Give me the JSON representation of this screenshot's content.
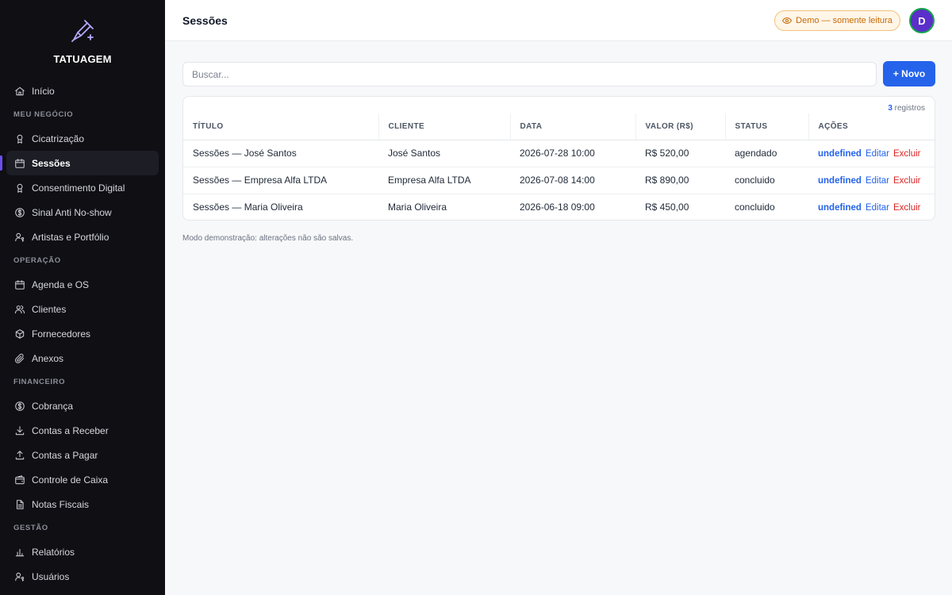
{
  "brand": {
    "name": "TATUAGEM"
  },
  "sidebar": {
    "items": [
      {
        "label": "Início",
        "icon": "home-icon"
      },
      {
        "section": "MEU NEGÓCIO"
      },
      {
        "label": "Cicatrização",
        "icon": "award-icon"
      },
      {
        "label": "Sessões",
        "icon": "calendar-icon",
        "active": true
      },
      {
        "label": "Consentimento Digital",
        "icon": "award-icon"
      },
      {
        "label": "Sinal Anti No-show",
        "icon": "dollar-circle-icon"
      },
      {
        "label": "Artistas e Portfólio",
        "icon": "user-key-icon"
      },
      {
        "section": "OPERAÇÃO"
      },
      {
        "label": "Agenda e OS",
        "icon": "calendar-icon"
      },
      {
        "label": "Clientes",
        "icon": "users-icon"
      },
      {
        "label": "Fornecedores",
        "icon": "box-icon"
      },
      {
        "label": "Anexos",
        "icon": "paperclip-icon"
      },
      {
        "section": "FINANCEIRO"
      },
      {
        "label": "Cobrança",
        "icon": "dollar-circle-icon"
      },
      {
        "label": "Contas a Receber",
        "icon": "download-icon"
      },
      {
        "label": "Contas a Pagar",
        "icon": "upload-icon"
      },
      {
        "label": "Controle de Caixa",
        "icon": "wallet-icon"
      },
      {
        "label": "Notas Fiscais",
        "icon": "file-icon"
      },
      {
        "section": "GESTÃO"
      },
      {
        "label": "Relatórios",
        "icon": "bar-chart-icon"
      },
      {
        "label": "Usuários",
        "icon": "user-key-icon"
      }
    ]
  },
  "header": {
    "title": "Sessões",
    "demo_badge": "Demo — somente leitura",
    "avatar_initial": "D"
  },
  "search": {
    "placeholder": "Buscar..."
  },
  "toolbar": {
    "new_label": "+ Novo"
  },
  "table": {
    "count": "3",
    "count_suffix": " registros",
    "columns": [
      "TÍTULO",
      "CLIENTE",
      "DATA",
      "VALOR (R$)",
      "STATUS",
      "AÇÕES"
    ],
    "rows": [
      {
        "titulo": "Sessões — José Santos",
        "cliente": "José Santos",
        "data": "2026-07-28 10:00",
        "valor": "R$ 520,00",
        "status": "agendado"
      },
      {
        "titulo": "Sessões — Empresa Alfa LTDA",
        "cliente": "Empresa Alfa LTDA",
        "data": "2026-07-08 14:00",
        "valor": "R$ 890,00",
        "status": "concluido"
      },
      {
        "titulo": "Sessões — Maria Oliveira",
        "cliente": "Maria Oliveira",
        "data": "2026-06-18 09:00",
        "valor": "R$ 450,00",
        "status": "concluido"
      }
    ],
    "actions": {
      "view": "undefined",
      "edit": "Editar",
      "delete": "Excluir"
    }
  },
  "footnote": "Modo demonstração: alterações não são salvas.",
  "colors": {
    "accent": "#2563eb",
    "danger": "#dc2626",
    "sidebar_bg": "#0f0f14",
    "active_marker": "#6d4ef0",
    "badge": "#c56a06"
  }
}
